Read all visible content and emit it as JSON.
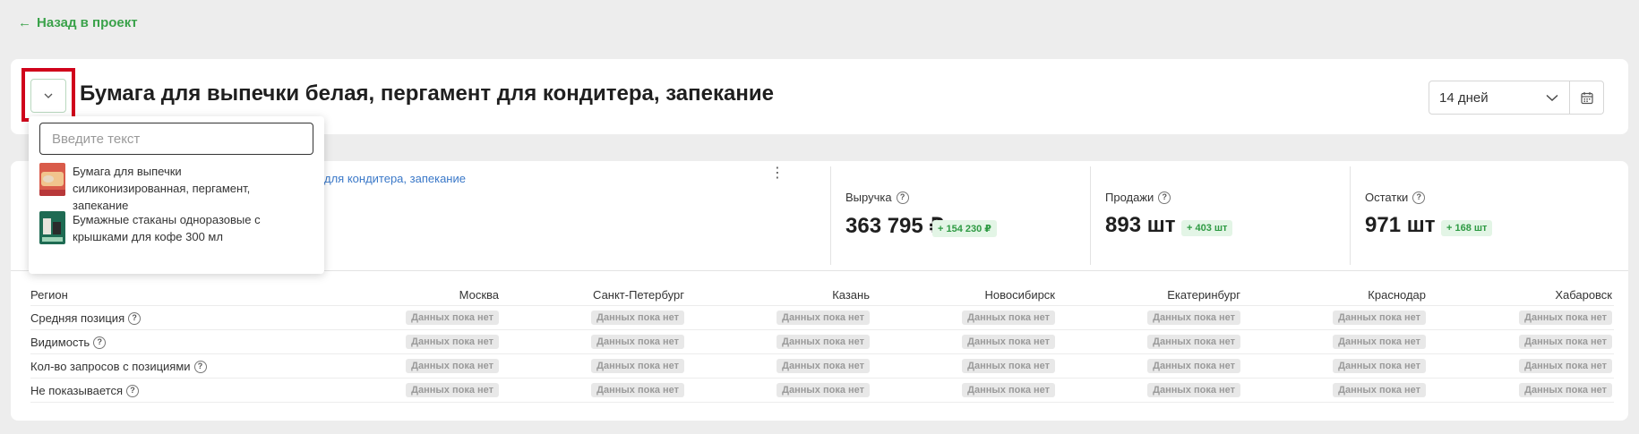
{
  "nav": {
    "back_label": "Назад в проект"
  },
  "header": {
    "title": "Бумага для выпечки белая, пергамент для кондитера, запекание",
    "period_selected": "14 дней"
  },
  "product": {
    "link_partial": "для кондитера, запекание"
  },
  "metrics": [
    {
      "label": "Выручка",
      "value": "363 795 ₽",
      "delta": "+ 154 230  ₽"
    },
    {
      "label": "Продажи",
      "value": "893 шт",
      "delta": "+ 403  шт"
    },
    {
      "label": "Остатки",
      "value": "971 шт",
      "delta": "+ 168  шт"
    }
  ],
  "regions_table": {
    "header_label": "Регион",
    "columns": [
      "Москва",
      "Санкт-Петербург",
      "Казань",
      "Новосибирск",
      "Екатеринбург",
      "Краснодар",
      "Хабаровск"
    ],
    "rows": [
      {
        "label": "Средняя позиция",
        "cells": [
          "Данных пока нет",
          "Данных пока нет",
          "Данных пока нет",
          "Данных пока нет",
          "Данных пока нет",
          "Данных пока нет",
          "Данных пока нет"
        ]
      },
      {
        "label": "Видимость",
        "cells": [
          "Данных пока нет",
          "Данных пока нет",
          "Данных пока нет",
          "Данных пока нет",
          "Данных пока нет",
          "Данных пока нет",
          "Данных пока нет"
        ]
      },
      {
        "label": "Кол-во запросов с позициями",
        "cells": [
          "Данных пока нет",
          "Данных пока нет",
          "Данных пока нет",
          "Данных пока нет",
          "Данных пока нет",
          "Данных пока нет",
          "Данных пока нет"
        ]
      },
      {
        "label": "Не показывается",
        "cells": [
          "Данных пока нет",
          "Данных пока нет",
          "Данных пока нет",
          "Данных пока нет",
          "Данных пока нет",
          "Данных пока нет",
          "Данных пока нет"
        ]
      }
    ]
  },
  "dropdown": {
    "search_placeholder": "Введите текст",
    "items": [
      {
        "text": "Бумага для выпечки силиконизированная, пергамент, запекание"
      },
      {
        "text": "Бумажные стаканы одноразовые с крышками для кофе 300 мл"
      }
    ]
  },
  "colors": {
    "accent_green": "#3aa24a",
    "link_blue": "#3a78c8",
    "highlight_red": "#d0021b",
    "delta_bg": "#e3f5e6"
  }
}
